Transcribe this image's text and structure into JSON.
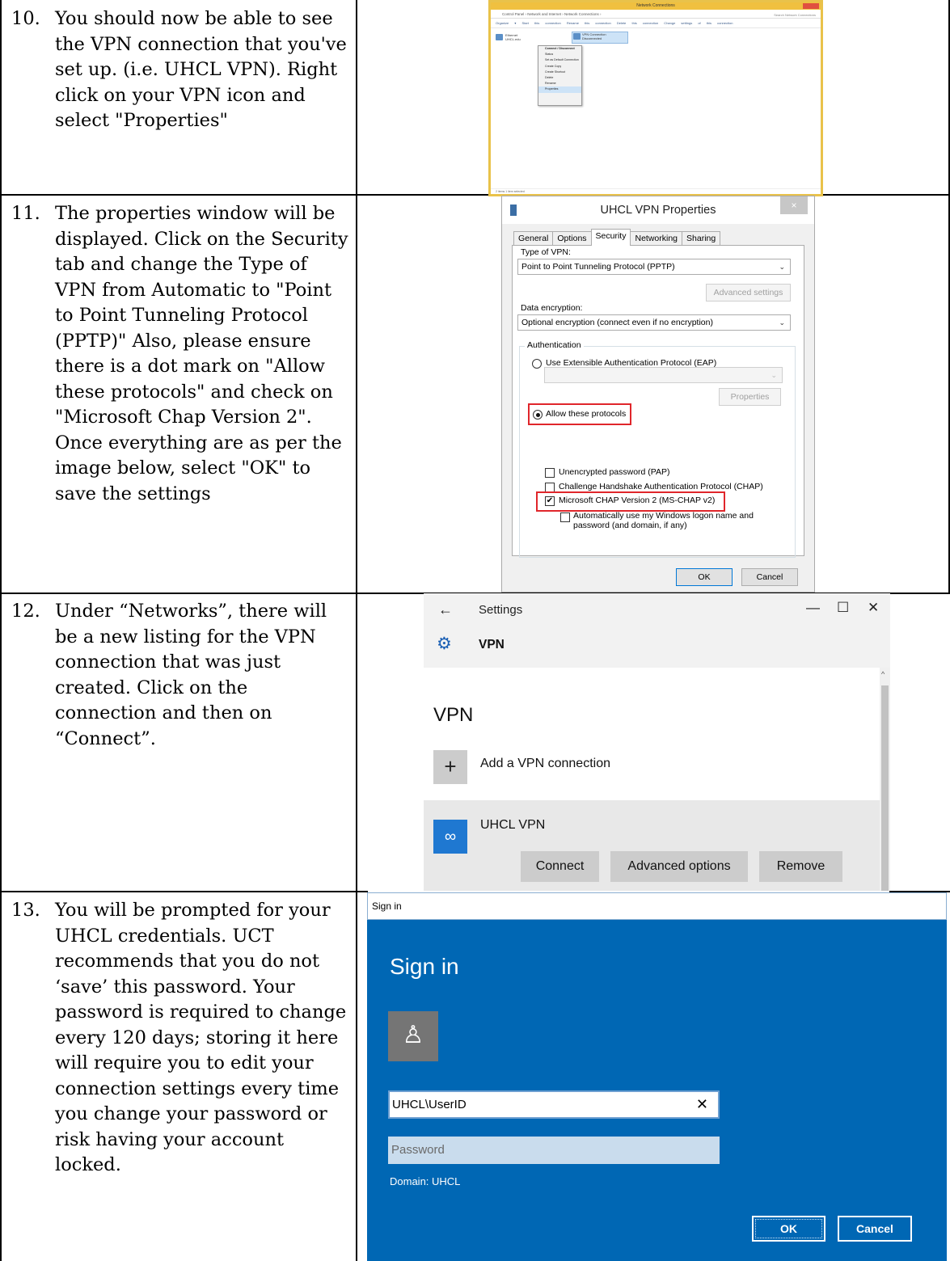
{
  "steps": [
    {
      "number": "10.",
      "text": "You should now be able to see the VPN connection that you've set up. (i.e. UHCL VPN).  Right click on your VPN icon and select \"Properties\""
    },
    {
      "number": "11.",
      "text": "The properties window will be displayed. Click on the Security tab and change the Type of VPN from Automatic to \"Point to Point Tunneling Protocol (PPTP)\" Also, please ensure there is a dot mark on \"Allow these protocols\" and check on \"Microsoft Chap Version 2\". Once everything are as per the image below, select \"OK\" to save the settings"
    },
    {
      "number": "12.",
      "text": "Under “Networks”, there will be a new listing for the VPN connection that was just created.  Click on the connection and then on “Connect”."
    },
    {
      "number": "13.",
      "text": "You will be prompted for your UHCL credentials.  UCT recommends that you do not ‘save’ this password.  Your password is required to change every 120 days; storing it here will require you to edit your connection settings every time you change your password or risk having your account locked."
    }
  ],
  "explorer": {
    "title": "Network Connections",
    "address": "Control Panel › Network and Internet › Network Connections ›",
    "search": "Search Network Connections",
    "commands": "Organize ▾  Start this connection  Rename this connection  Delete this connection  Change settings of this connection",
    "items": [
      {
        "name": "Ethernet",
        "sub": "UHCL.edu"
      },
      {
        "name": "VPN Connection",
        "sub": "Disconnected"
      }
    ],
    "context_menu": [
      "Connect / Disconnect",
      "Status",
      "Set as Default Connection",
      "Create Copy",
      "Create Shortcut",
      "Delete",
      "Rename",
      "Properties"
    ],
    "status": "2 items    1 item selected"
  },
  "properties": {
    "title": "UHCL VPN Properties",
    "close_glyph": "×",
    "tabs": [
      "General",
      "Options",
      "Security",
      "Networking",
      "Sharing"
    ],
    "active_tab": "Security",
    "type_label": "Type of VPN:",
    "type_value": "Point to Point Tunneling Protocol (PPTP)",
    "advanced_button": "Advanced settings",
    "encryption_label": "Data encryption:",
    "encryption_value": "Optional encryption (connect even if no encryption)",
    "auth_group": "Authentication",
    "eap_radio": "Use Extensible Authentication Protocol (EAP)",
    "properties_button": "Properties",
    "allow_radio": "Allow these protocols",
    "pap": "Unencrypted password (PAP)",
    "chap": "Challenge Handshake Authentication Protocol (CHAP)",
    "mschap": "Microsoft CHAP Version 2 (MS-CHAP v2)",
    "auto_logon_1": "Automatically use my Windows logon name and",
    "auto_logon_2": "password (and domain, if any)",
    "ok": "OK",
    "cancel": "Cancel",
    "check_glyph": "✔",
    "arrow_glyph": "⌄",
    "highlight_color": "#e0262b"
  },
  "settings": {
    "back_glyph": "←",
    "app_title": "Settings",
    "min_glyph": "—",
    "max_glyph": "☐",
    "close_glyph": "✕",
    "gear_glyph": "⚙",
    "page_title": "VPN",
    "up_glyph": "^",
    "section_title": "VPN",
    "plus_glyph": "+",
    "add_label": "Add a VPN connection",
    "vpn_glyph": "∞",
    "connection_name": "UHCL VPN",
    "connect": "Connect",
    "advanced": "Advanced options",
    "remove": "Remove",
    "accent": "#1f78d1"
  },
  "signin": {
    "window_title": "Sign in",
    "heading": "Sign in",
    "avatar_glyph": "♙",
    "username": "UHCL\\UserID",
    "clear_glyph": "✕",
    "password_placeholder": "Password",
    "domain": "Domain: UHCL",
    "ok": "OK",
    "cancel": "Cancel",
    "background": "#0067b4"
  }
}
